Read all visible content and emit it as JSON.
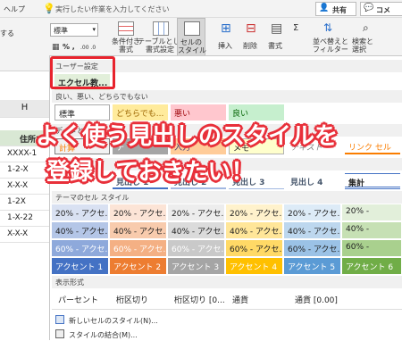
{
  "top": {
    "help": "ヘルプ",
    "tellme": "実行したい作業を入力してください",
    "share": "共有",
    "comment": "コメ"
  },
  "ribbon": {
    "font_box": "標準",
    "left_label": "する",
    "cond_format": "条件付き\n書式",
    "table_format": "テーブルとして\n書式設定",
    "cell_style": "セルの\nスタイル",
    "insert": "挿入",
    "delete": "削除",
    "format": "書式",
    "sort": "並べ替えと\nフィルター",
    "find": "検索と\n選択",
    "number_symbols": "% ,",
    "decimal": ".00 .0"
  },
  "sheet": {
    "col_header": "H",
    "header_cell": "住所2",
    "rows": [
      "XXXX-1",
      "1-2-X",
      "X-X-X",
      "1-2X",
      "1-X-22",
      "X-X-X"
    ]
  },
  "gallery": {
    "user_section": "ユーザー設定",
    "user_style": "エクセル教...",
    "good_bad_section": "良い、悪い、どちらでもない",
    "good_bad": [
      "標準",
      "どちらでも...",
      "悪い",
      "良い"
    ],
    "data_section": "データとモデル",
    "data_items": [
      "計算",
      "チ",
      "入力",
      "メモ",
      "テキスト",
      "リンク セル"
    ],
    "title_section": "タイトル",
    "headings": [
      "見出し 1",
      "見出し 2",
      "見出し 3",
      "見出し 4",
      "集計"
    ],
    "theme_section": "テーマのセル スタイル",
    "row20": [
      "20% - アクセ...",
      "20% - アクセ...",
      "20% - アクセ...",
      "20% - アクセ...",
      "20% - アクセ...",
      "20% -"
    ],
    "row40": [
      "40% - アクセ...",
      "40% - アクセ...",
      "40% - アクセ...",
      "40% - アクセ...",
      "40% - アクセ...",
      "40% -"
    ],
    "row60": [
      "60% - アクセ...",
      "60% - アクセ...",
      "60% - アクセ...",
      "60% - アクセ...",
      "60% - アクセ...",
      "60% -"
    ],
    "accent": [
      "アクセント 1",
      "アクセント 2",
      "アクセント 3",
      "アクセント 4",
      "アクセント 5",
      "アクセント 6"
    ],
    "number_section": "表示形式",
    "number_items": [
      "パーセント",
      "桁区切り",
      "桁区切り [0...",
      "通貨",
      "通貨 [0.00]"
    ],
    "new_style": "新しいセルのスタイル(N)...",
    "merge_style": "スタイルの結合(M)..."
  },
  "overlay": {
    "line1": "よく使う見出しのスタイルを",
    "line2": "登録しておきたい！"
  },
  "colors": {
    "accent": "#e8303a",
    "selection": "#e8232d"
  }
}
